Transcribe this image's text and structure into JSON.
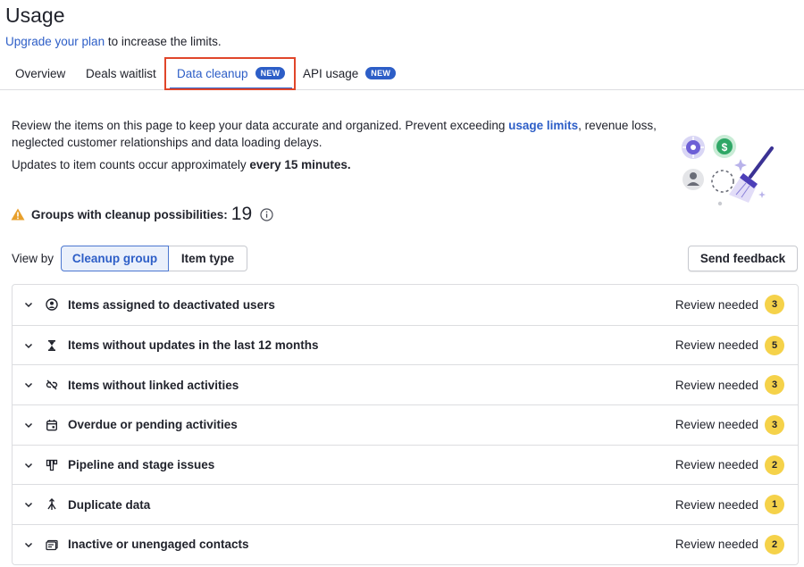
{
  "header": {
    "title": "Usage",
    "upgrade_link": "Upgrade your plan",
    "upgrade_rest": " to increase the limits."
  },
  "tabs": [
    {
      "label": "Overview",
      "badge": ""
    },
    {
      "label": "Deals waitlist",
      "badge": ""
    },
    {
      "label": "Data cleanup",
      "badge": "NEW",
      "active": true
    },
    {
      "label": "API usage",
      "badge": "NEW"
    }
  ],
  "intro": {
    "text_before": "Review the items on this page to keep your data accurate and organized. Prevent exceeding ",
    "link": "usage limits",
    "text_after": ", revenue loss, neglected customer relationships and data loading delays.",
    "updates_before": "Updates to item counts occur approximately ",
    "updates_bold": "every 15 minutes."
  },
  "groups": {
    "label": "Groups with cleanup possibilities:",
    "count": "19"
  },
  "view": {
    "label": "View by",
    "options": [
      "Cleanup group",
      "Item type"
    ],
    "selected": "Cleanup group",
    "feedback": "Send feedback"
  },
  "rows": [
    {
      "label": "Items assigned to deactivated users",
      "status": "Review needed",
      "count": "3",
      "icon": "user-circle-icon"
    },
    {
      "label": "Items without updates in the last 12 months",
      "status": "Review needed",
      "count": "5",
      "icon": "hourglass-icon"
    },
    {
      "label": "Items without linked activities",
      "status": "Review needed",
      "count": "3",
      "icon": "unlinked-icon"
    },
    {
      "label": "Overdue or pending activities",
      "status": "Review needed",
      "count": "3",
      "icon": "calendar-icon"
    },
    {
      "label": "Pipeline and stage issues",
      "status": "Review needed",
      "count": "2",
      "icon": "pipeline-icon"
    },
    {
      "label": "Duplicate data",
      "status": "Review needed",
      "count": "1",
      "icon": "merge-icon"
    },
    {
      "label": "Inactive or unengaged contacts",
      "status": "Review needed",
      "count": "2",
      "icon": "contact-card-icon"
    }
  ],
  "colors": {
    "accent": "#2d5ec7",
    "highlight": "#e0462a",
    "count_badge": "#f5d24a",
    "warning": "#e8a02c"
  }
}
